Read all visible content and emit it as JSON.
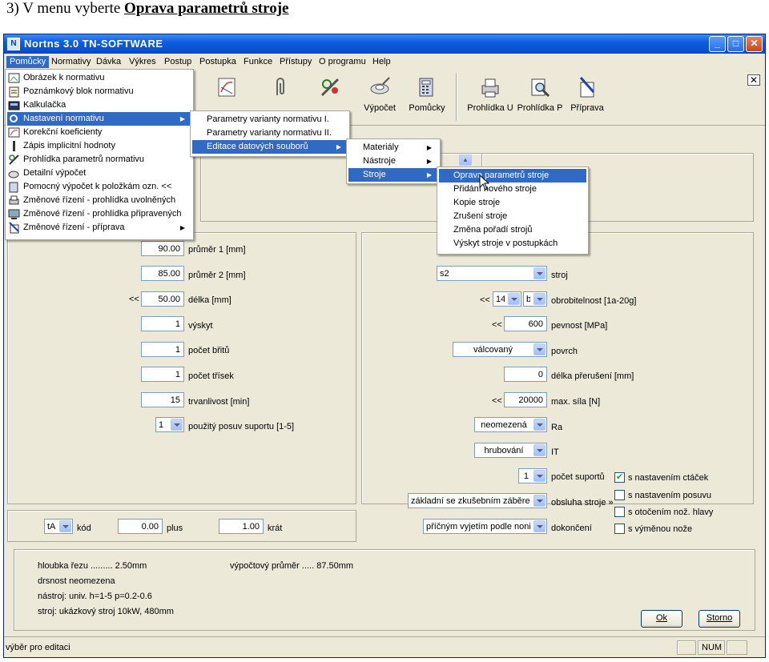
{
  "heading": {
    "prefix": "3) V menu vyberte ",
    "target": "Oprava parametrů stroje"
  },
  "window": {
    "title": "Nortns 3.0 TN-SOFTWARE"
  },
  "menubar": [
    "Pomůcky",
    "Normativy",
    "Dávka",
    "Výkres",
    "Postup",
    "Postupka",
    "Funkce",
    "Přístupy",
    "O programu",
    "Help"
  ],
  "toolbar": [
    "Výpočet",
    "Pomůcky",
    "Prohlídka U",
    "Prohlídka P",
    "Příprava"
  ],
  "menus": {
    "pomucky": [
      "Obrázek k normativu",
      "Poznámkový blok normativu",
      "Kalkulačka",
      "Nastavení normativu",
      "Korekční koeficienty",
      "Zápis implicitní hodnoty",
      "Prohlídka parametrů normativu",
      "Detailní výpočet",
      "Pomocný výpočet k položkám ozn. <<",
      "Změnové řízení - prohlídka uvolněných",
      "Změnové řízení - prohlídka připravených",
      "Změnové řízení - příprava"
    ],
    "nastaveni": [
      "Parametry varianty normativu I.",
      "Parametry varianty normativu II.",
      "Editace datových souborů"
    ],
    "editace": [
      "Materiály",
      "Nástroje",
      "Stroje"
    ],
    "stroje": [
      "Oprava parametrů stroje",
      "Přidání nového stroje",
      "Kopie stroje",
      "Zrušení stroje",
      "Změna pořadí strojů",
      "Výskyt stroje v postupkách"
    ]
  },
  "left": {
    "prumer1": {
      "value": "90.00",
      "label": "průměr 1 [mm]"
    },
    "prumer2": {
      "value": "85.00",
      "label": "průměr 2 [mm]"
    },
    "delka": {
      "marker": "<<",
      "value": "50.00",
      "label": "délka [mm]"
    },
    "vyskyt": {
      "value": "1",
      "label": "výskyt"
    },
    "britu": {
      "value": "1",
      "label": "počet břitů"
    },
    "trisek": {
      "value": "1",
      "label": "počet třísek"
    },
    "trvanlivost": {
      "value": "15",
      "label": "trvanlivost [min]"
    },
    "posuv": {
      "value": "1",
      "label": "použitý posuv suportu [1-5]"
    }
  },
  "right": {
    "stroj": {
      "value": "s2",
      "label": "stroj"
    },
    "obrobitelnost": {
      "marker": "<<",
      "value1": "14",
      "value2": "b",
      "label": "obrobitelnost [1a-20g]"
    },
    "pevnost": {
      "marker": "<<",
      "value": "600",
      "label": "pevnost [MPa]"
    },
    "povrch": {
      "value": "válcovaný",
      "label": "povrch"
    },
    "preruseni": {
      "value": "0",
      "label": "délka přerušení [mm]"
    },
    "sila": {
      "marker": "<<",
      "value": "20000",
      "label": "max. síla [N]"
    },
    "ra": {
      "value": "neomezená",
      "label": "Ra"
    },
    "it": {
      "value": "hrubování",
      "label": "IT"
    },
    "suportu": {
      "value": "1",
      "label": "počet suportů"
    },
    "obsluha": {
      "value": "základní se zkušebním záběrem",
      "label": "obsluha stroje »"
    },
    "dokonceni": {
      "value": "příčným vyjetím podle nonia",
      "label": "dokončení"
    }
  },
  "checks": [
    {
      "label": "s nastavením ctáček",
      "checked": true
    },
    {
      "label": "s nastavením posuvu",
      "checked": false
    },
    {
      "label": "s otočením nož. hlavy",
      "checked": false
    },
    {
      "label": "s výměnou nože",
      "checked": false
    }
  ],
  "code_row": {
    "code": "tA",
    "code_label": "kód",
    "plus_value": "0.00",
    "plus_label": "plus",
    "krat_value": "1.00",
    "krat_label": "krát"
  },
  "summary": {
    "line1": "hloubka řezu ......... 2.50mm",
    "line1b": "výpočtový průměr .....   87.50mm",
    "line2": "drsnost neomezena",
    "line3": "nástroj: univ. h=1-5 p=0.2-0.6",
    "line4": "stroj: ukázkový stroj 10kW, 480mm"
  },
  "buttons": {
    "ok": "Ok",
    "storno": "Storno"
  },
  "status": {
    "text": "výběr pro editaci",
    "num": "NUM"
  }
}
